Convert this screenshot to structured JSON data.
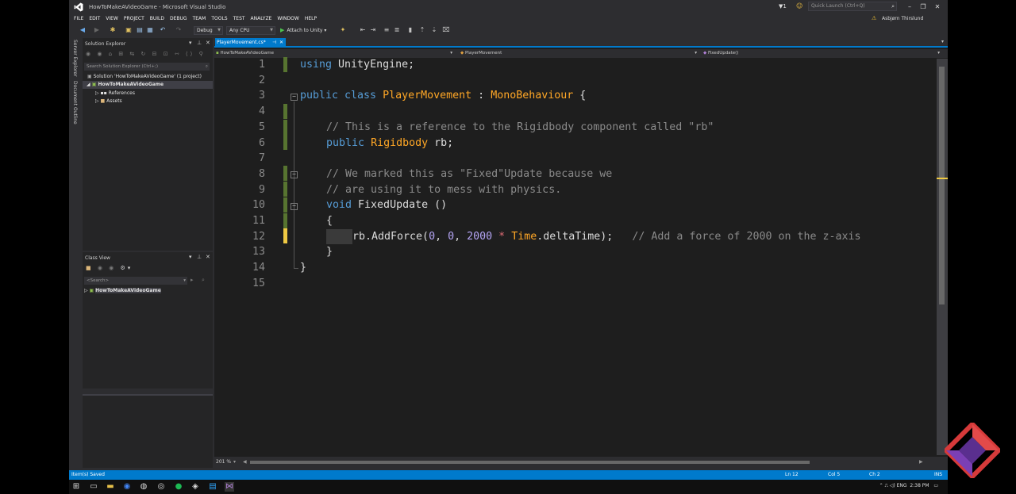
{
  "window": {
    "title": "HowToMakeAVideoGame - Microsoft Visual Studio",
    "notifications": "1",
    "quick_launch_placeholder": "Quick Launch (Ctrl+Q)",
    "user": "Asbjørn Thirslund"
  },
  "menu": [
    "FILE",
    "EDIT",
    "VIEW",
    "PROJECT",
    "BUILD",
    "DEBUG",
    "TEAM",
    "TOOLS",
    "TEST",
    "ANALYZE",
    "WINDOW",
    "HELP"
  ],
  "toolbar": {
    "config": "Debug",
    "platform": "Any CPU",
    "attach_label": "Attach to Unity"
  },
  "side_tabs": {
    "server_explorer": "Server Explorer",
    "document_outline": "Document Outline"
  },
  "solution_explorer": {
    "title": "Solution Explorer",
    "search_placeholder": "Search Solution Explorer (Ctrl+;)",
    "solution": "Solution 'HowToMakeAVideoGame' (1 project)",
    "project": "HowToMakeAVideoGame",
    "items": [
      "References",
      "Assets"
    ]
  },
  "class_view": {
    "title": "Class View",
    "search_placeholder": "<Search>",
    "item": "HowToMakeAVideoGame"
  },
  "editor": {
    "tab_label": "PlayerMovement.cs*",
    "nav_project": "HowToMakeAVideoGame",
    "nav_class": "PlayerMovement",
    "nav_member": "FixedUpdate()",
    "zoom": "201 %",
    "line_numbers": [
      "1",
      "2",
      "3",
      "4",
      "5",
      "6",
      "7",
      "8",
      "9",
      "10",
      "11",
      "12",
      "13",
      "14",
      "15"
    ],
    "code": {
      "l1_kw": "using",
      "l1_rest": " UnityEngine;",
      "l3_kw": "public class",
      "l3_type": "PlayerMovement",
      "l3_colon": " : ",
      "l3_base": "MonoBehaviour",
      "l3_brace": " {",
      "l5_comment": "// This is a reference to the Rigidbody component called \"rb\"",
      "l6_kw": "public",
      "l6_type": "Rigidbody",
      "l6_rest": " rb;",
      "l8_comment": "// We marked this as \"Fixed\"Update because we",
      "l9_comment": "// are using it to mess with physics.",
      "l10_kw": "void",
      "l10_rest": " FixedUpdate ()",
      "l11": "{",
      "l12_a": "rb.AddForce(",
      "l12_n1": "0",
      "l12_c1": ", ",
      "l12_n2": "0",
      "l12_c2": ", ",
      "l12_n3": "2000",
      "l12_op": " * ",
      "l12_type": "Time",
      "l12_rest": ".deltaTime);",
      "l12_comment": "// Add a force of 2000 on the z-axis",
      "l13": "}",
      "l14": "}"
    }
  },
  "status": {
    "message": "Item(s) Saved",
    "ln": "Ln 12",
    "col": "Col 5",
    "ch": "Ch 2",
    "mode": "INS"
  },
  "taskbar": {
    "lang": "ENG",
    "time": "2:38 PM"
  },
  "colors": {
    "accent": "#007acc",
    "keyword": "#569cd6",
    "type": "#ffa726",
    "comment": "#8a8a8a",
    "number": "#b5a5f5"
  }
}
